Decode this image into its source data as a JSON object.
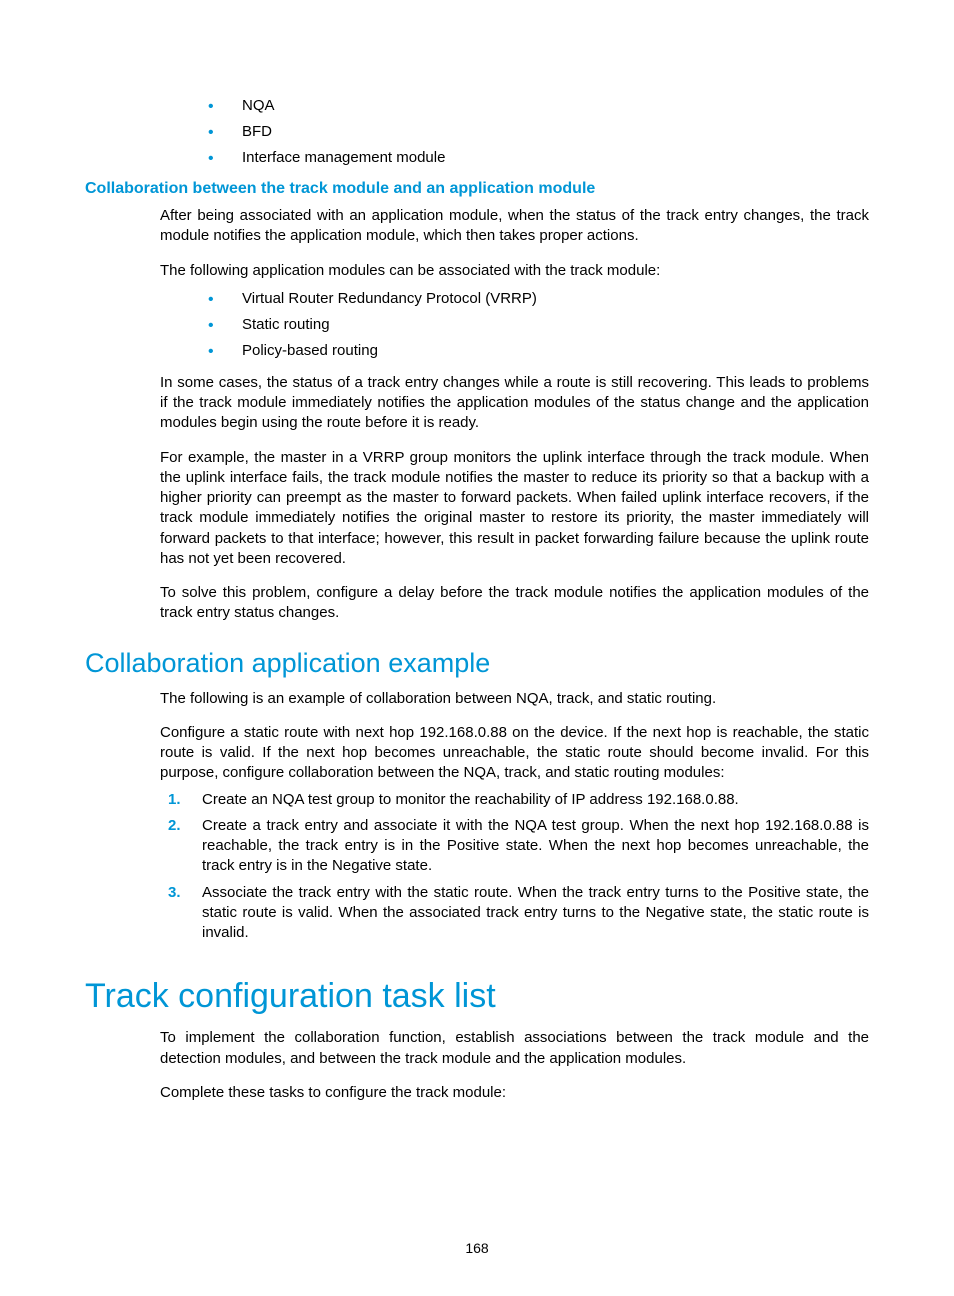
{
  "topBullets": [
    "NQA",
    "BFD",
    "Interface management module"
  ],
  "h3_collab": "Collaboration between the track module and an application module",
  "p1": "After being associated with an application module, when the status of the track entry changes, the track module notifies the application module, which then takes proper actions.",
  "p2": "The following application modules can be associated with the track module:",
  "appBullets": [
    "Virtual Router Redundancy Protocol (VRRP)",
    "Static routing",
    "Policy-based routing"
  ],
  "p3": "In some cases, the status of a track entry changes while a route is still recovering. This leads to problems if the track module immediately notifies the application modules of the status change and the application modules begin using the route before it is ready.",
  "p4": "For example, the master in a VRRP group monitors the uplink interface through the track module. When the uplink interface fails, the track module notifies the master to reduce its priority so that a backup with a higher priority can preempt as the master to forward packets. When failed uplink interface recovers, if the track module immediately notifies the original master to restore its priority, the master immediately will forward packets to that interface; however, this result in packet forwarding failure because the uplink route has not yet been recovered.",
  "p5": "To solve this problem, configure a delay before the track module notifies the application modules of the track entry status changes.",
  "h2_example": "Collaboration application example",
  "p6": "The following is an example of collaboration between NQA, track, and static routing.",
  "p7": "Configure a static route with next hop 192.168.0.88 on the device. If the next hop is reachable, the static route is valid. If the next hop becomes unreachable, the static route should become invalid. For this purpose, configure collaboration between the NQA, track, and static routing modules:",
  "steps": [
    "Create an NQA test group to monitor the reachability of IP address 192.168.0.88.",
    "Create a track entry and associate it with the NQA test group. When the next hop 192.168.0.88 is reachable, the track entry is in the Positive state. When the next hop becomes unreachable, the track entry is in the Negative state.",
    "Associate the track entry with the static route. When the track entry turns to the Positive state, the static route is valid. When the associated track entry turns to the Negative state, the static route is invalid."
  ],
  "stepNums": [
    "1.",
    "2.",
    "3."
  ],
  "h1_tasklist": "Track configuration task list",
  "p8": "To implement the collaboration function, establish associations between the track module and the detection modules, and between the track module and the application modules.",
  "p9": "Complete these tasks to configure the track module:",
  "pageNumber": "168"
}
